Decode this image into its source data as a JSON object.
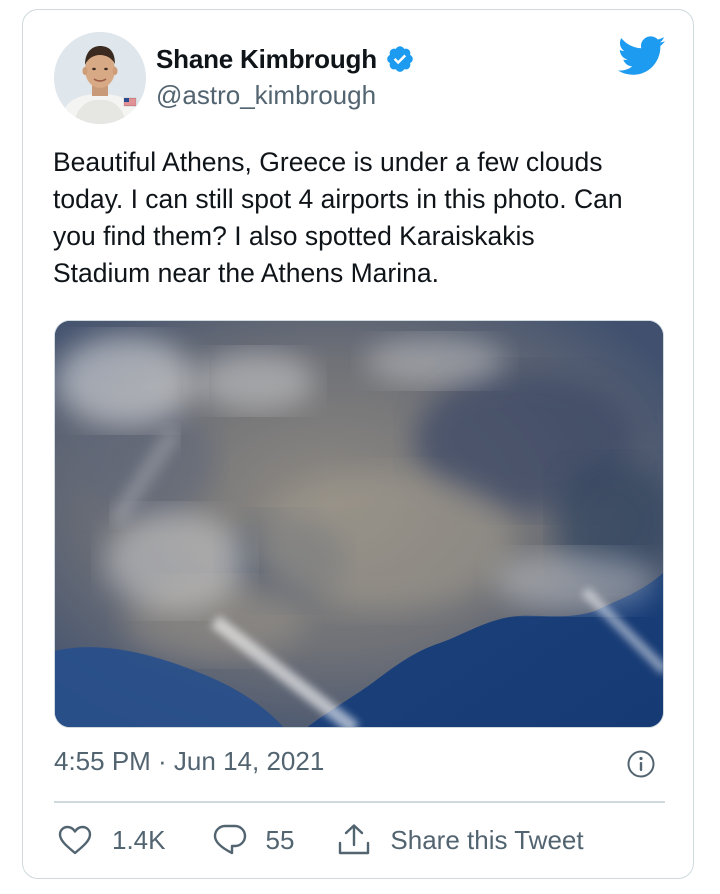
{
  "tweet": {
    "author": {
      "display_name": "Shane Kimbrough",
      "handle": "@astro_kimbrough",
      "verified": true,
      "avatar_icon": "astronaut-portrait"
    },
    "text": "Beautiful Athens, Greece is under a few clouds\ntoday. I can still spot 4 airports in this photo. Can\nyou find them? I also spotted Karaiskakis\nStadium near the Athens Marina.",
    "timestamp": "4:55 PM · Jun 14, 2021",
    "actions": {
      "like_count": "1.4K",
      "reply_count": "55",
      "share_label": "Share this Tweet"
    }
  },
  "icons": {
    "brand": "twitter-bird-icon",
    "verified": "verified-badge-icon",
    "info": "info-icon",
    "like": "heart-icon",
    "reply": "reply-bubble-icon",
    "share": "share-upload-icon"
  },
  "colors": {
    "twitter_blue": "#1d9bf0",
    "text_primary": "#0f1419",
    "text_secondary": "#536471",
    "border": "#cfd9de"
  }
}
